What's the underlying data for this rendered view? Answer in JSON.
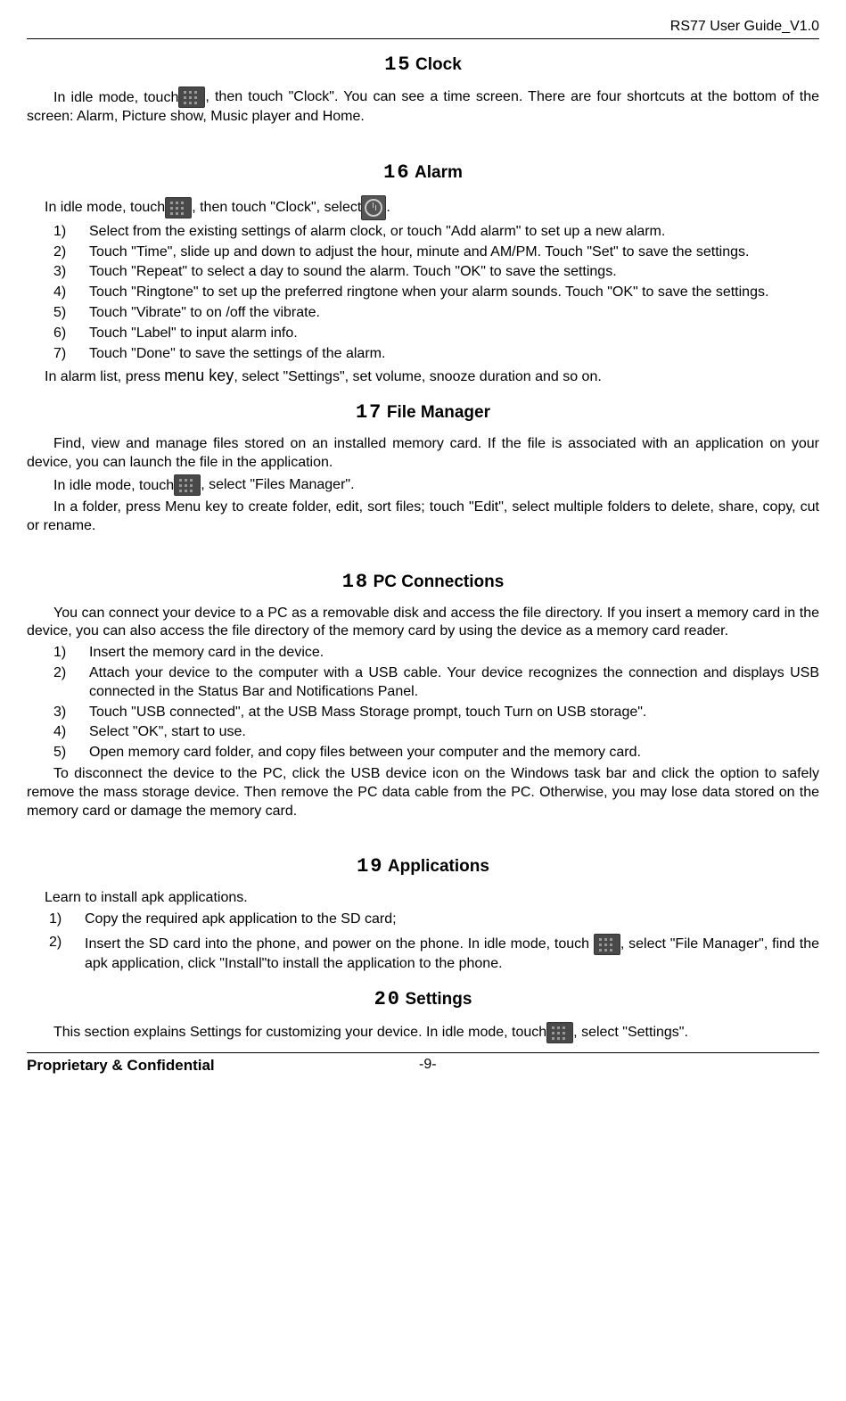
{
  "header": "RS77 User Guide_V1.0",
  "s15": {
    "num": "15",
    "title": "Clock",
    "p1a": "In idle mode, touch",
    "p1b": ", then touch \"Clock\". You can see a time screen. There are four shortcuts at the bottom of the screen: Alarm, Picture show, Music player and Home."
  },
  "s16": {
    "num": "16",
    "title": "Alarm",
    "p1a": "In idle mode, touch",
    "p1b": ", then touch \"Clock\", select",
    "p1c": ".",
    "items": [
      "Select from the existing settings of alarm clock, or touch \"Add alarm\" to set up a new alarm.",
      "Touch \"Time\", slide up and down to adjust the hour, minute and AM/PM. Touch \"Set\" to save the settings.",
      "Touch \"Repeat\" to select a day to sound the alarm. Touch \"OK\" to save the settings.",
      "Touch \"Ringtone\" to set up the preferred ringtone when your alarm sounds. Touch \"OK\" to save the settings.",
      "Touch \"Vibrate\" to on /off the vibrate.",
      "Touch \"Label\" to input alarm info.",
      "Touch \"Done\" to save the settings of the alarm."
    ],
    "p2a": "In alarm list, press ",
    "p2b": "menu key",
    "p2c": ", select \"Settings\", set volume, snooze duration and so on."
  },
  "s17": {
    "num": "17",
    "title": "File Manager",
    "p1": "Find, view and manage files stored on an installed memory card. If the file is associated with an application on your device, you can launch the file in the application.",
    "p2a": "In idle mode, touch",
    "p2b": ", select \"Files Manager\".",
    "p3": "In a folder, press Menu key to create folder, edit, sort files; touch \"Edit\", select multiple folders to delete, share, copy, cut or rename."
  },
  "s18": {
    "num": "18",
    "title": "PC Connections",
    "p1": "You can connect your device to a PC as a removable disk and access the file directory. If you insert a memory card in the device, you can also access the file directory of the memory card by using the device as a memory card reader.",
    "items": [
      "Insert the memory card in the device.",
      "Attach your device to the computer with a USB cable. Your device recognizes the connection and displays USB connected in the Status Bar and Notifications Panel.",
      "Touch \"USB connected\", at the USB Mass Storage prompt, touch Turn on USB storage\".",
      "Select \"OK\", start to use.",
      "Open memory card folder, and copy files between your computer and the memory card."
    ],
    "p2": "To disconnect the device to the PC, click the USB device icon on the Windows task bar and click the option to safely remove the mass storage device. Then remove the PC data cable from the PC. Otherwise, you may lose data stored on the memory card or damage the memory card."
  },
  "s19": {
    "num": "19",
    "title": "Applications",
    "p1": "Learn to install apk applications.",
    "item1": "Copy the required apk application to the SD card;",
    "item2a": "Insert the SD card into the phone, and power on the phone. In idle mode, touch ",
    "item2b": ", select \"File Manager\", find the apk application, click \"Install\"to install the application to the phone."
  },
  "s20": {
    "num": "20",
    "title": "Settings",
    "p1a": "This section explains Settings for customizing your device. In idle mode, touch",
    "p1b": ", select \"Settings\"."
  },
  "footer": {
    "left": "Proprietary & Confidential",
    "center": "-9-"
  }
}
